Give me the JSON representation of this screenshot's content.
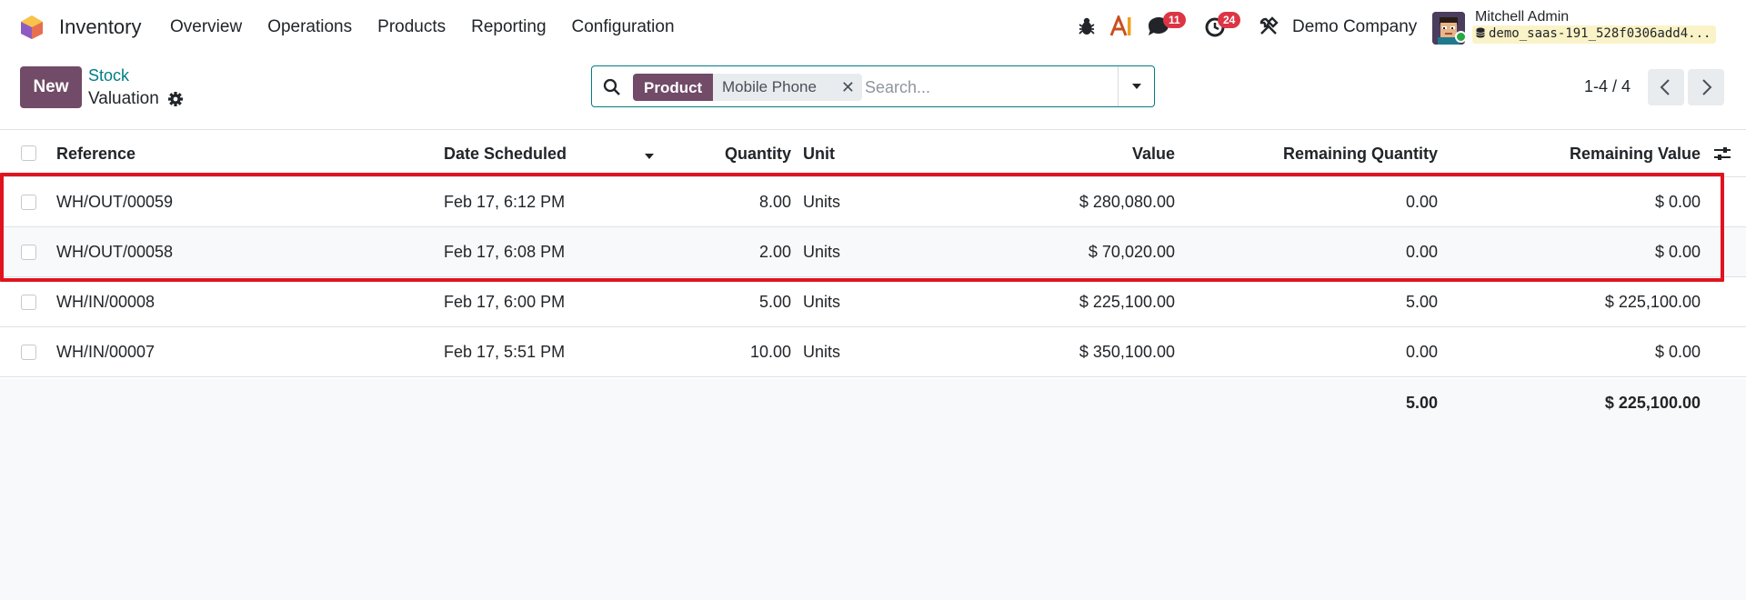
{
  "app": {
    "name": "Inventory"
  },
  "menu": [
    "Overview",
    "Operations",
    "Products",
    "Reporting",
    "Configuration"
  ],
  "systray": {
    "messages_count": "11",
    "activities_count": "24",
    "company": "Demo Company",
    "user_name": "Mitchell Admin",
    "database": "demo_saas-191_528f0306add4..."
  },
  "control": {
    "new_label": "New",
    "breadcrumb_parent": "Stock",
    "breadcrumb_current": "Valuation",
    "pager": "1-4 / 4"
  },
  "search": {
    "facet_label": "Product",
    "facet_value": "Mobile Phone",
    "placeholder": "Search..."
  },
  "table": {
    "columns": [
      "Reference",
      "Date Scheduled",
      "Quantity",
      "Unit",
      "Value",
      "Remaining Quantity",
      "Remaining Value"
    ],
    "rows": [
      {
        "reference": "WH/OUT/00059",
        "date": "Feb 17, 6:12 PM",
        "quantity": "8.00",
        "unit": "Units",
        "value": "$ 280,080.00",
        "remaining_qty": "0.00",
        "remaining_value": "$ 0.00"
      },
      {
        "reference": "WH/OUT/00058",
        "date": "Feb 17, 6:08 PM",
        "quantity": "2.00",
        "unit": "Units",
        "value": "$ 70,020.00",
        "remaining_qty": "0.00",
        "remaining_value": "$ 0.00"
      },
      {
        "reference": "WH/IN/00008",
        "date": "Feb 17, 6:00 PM",
        "quantity": "5.00",
        "unit": "Units",
        "value": "$ 225,100.00",
        "remaining_qty": "5.00",
        "remaining_value": "$ 225,100.00"
      },
      {
        "reference": "WH/IN/00007",
        "date": "Feb 17, 5:51 PM",
        "quantity": "10.00",
        "unit": "Units",
        "value": "$ 350,100.00",
        "remaining_qty": "0.00",
        "remaining_value": "$ 0.00"
      }
    ],
    "totals": {
      "remaining_qty": "5.00",
      "remaining_value": "$ 225,100.00"
    }
  },
  "colors": {
    "brand": "#714b67",
    "link": "#017e84",
    "highlight": "#e0141e",
    "badge": "#dc3545"
  }
}
